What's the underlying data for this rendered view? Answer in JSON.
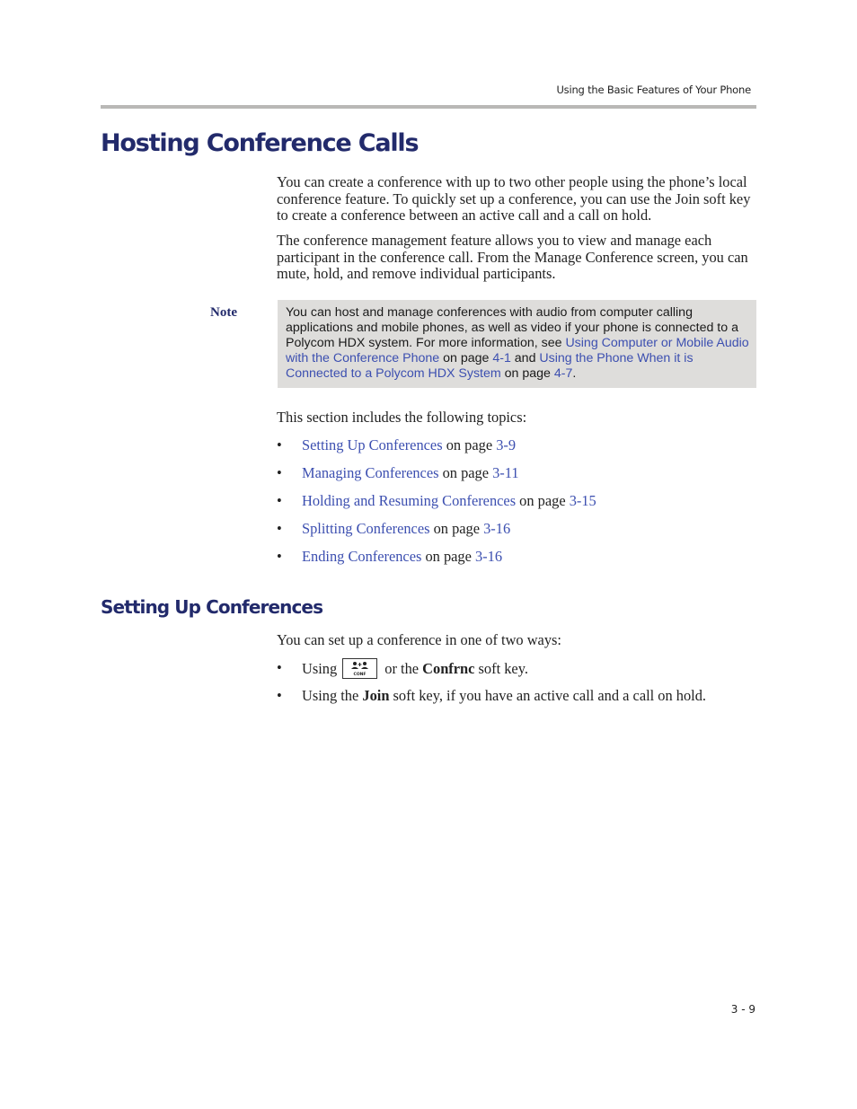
{
  "header": {
    "running_title": "Using the Basic Features of Your Phone"
  },
  "section": {
    "title": "Hosting Conference Calls",
    "paragraphs": [
      "You can create a conference with up to two other people using the phone’s local conference feature. To quickly set up a conference, you can use the Join soft key to create a conference between an active call and a call on hold.",
      "The conference management feature allows you to view and manage each participant in the conference call. From the Manage Conference screen, you can mute, hold, and remove individual participants."
    ]
  },
  "note": {
    "label": "Note",
    "text_1": "You can host and manage conferences with audio from computer calling applications and mobile phones, as well as video if your phone is connected to a Polycom HDX system. For more information, see ",
    "link_1": "Using Computer or Mobile Audio with the Conference Phone",
    "text_2": " on page ",
    "page_1": "4-1",
    "text_3": " and ",
    "link_2": "Using the Phone When it is Connected to a Polycom HDX System",
    "text_4": " on page ",
    "page_2": "4-7",
    "text_5": "."
  },
  "topics": {
    "intro": "This section includes the following topics:",
    "bullet": "•",
    "on_page": " on page ",
    "items": [
      {
        "label": "Setting Up Conferences",
        "page": "3-9"
      },
      {
        "label": "Managing Conferences",
        "page": "3-11"
      },
      {
        "label": "Holding and Resuming Conferences",
        "page": "3-15"
      },
      {
        "label": "Splitting Conferences",
        "page": "3-16"
      },
      {
        "label": "Ending Conferences",
        "page": "3-16"
      }
    ]
  },
  "setup": {
    "title": "Setting Up Conferences",
    "intro": "You can set up a conference in one of two ways:",
    "bullet": "•",
    "way_1": {
      "prefix": "Using",
      "key_icon": "conference-key-icon",
      "key_caption": "CONF",
      "middle": " or the ",
      "bold": "Confrnc",
      "suffix": " soft key."
    },
    "way_2": {
      "prefix": "Using the ",
      "bold": "Join",
      "suffix": " soft key, if you have an active call and a call on hold."
    }
  },
  "footer": {
    "page_number": "3 - 9"
  },
  "colors": {
    "heading": "#222a6b",
    "link": "#3c4fb0",
    "note_background": "#dedddb",
    "rule": "#b9b8b6"
  }
}
